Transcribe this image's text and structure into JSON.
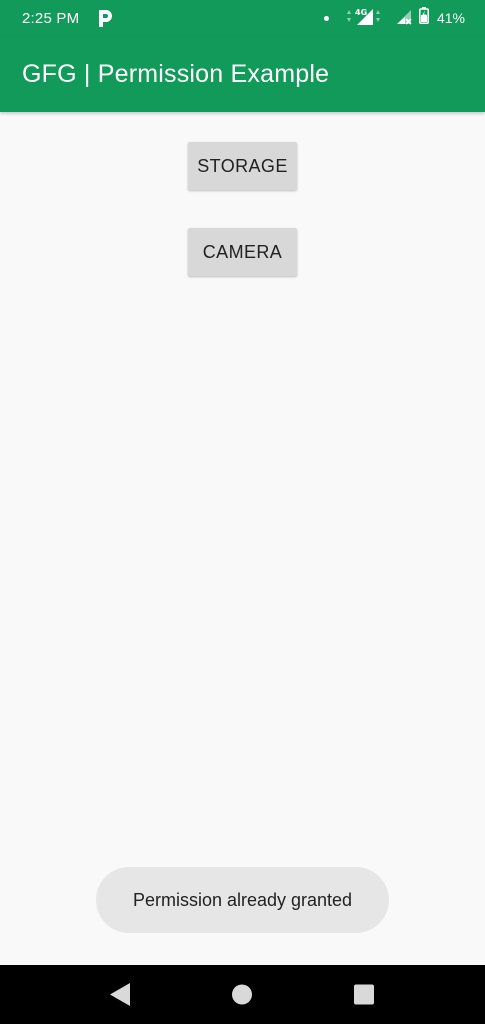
{
  "status_bar": {
    "time": "2:25 PM",
    "network_type": "4G",
    "battery": "41%",
    "icons": [
      "parking-app-icon",
      "notification-dot-icon",
      "signal-4g-icon",
      "signal-no-service-icon",
      "battery-icon"
    ]
  },
  "app_bar": {
    "title": "GFG | Permission Example",
    "color": "#129a5a"
  },
  "main": {
    "storage_button": "STORAGE",
    "camera_button": "CAMERA"
  },
  "toast": {
    "message": "Permission already granted"
  },
  "nav_bar": {
    "icons": [
      "back-icon",
      "home-icon",
      "recents-icon"
    ]
  }
}
